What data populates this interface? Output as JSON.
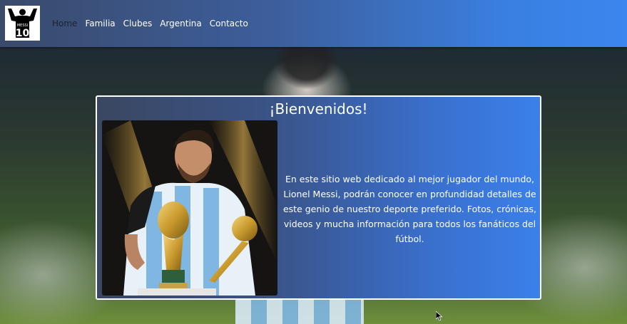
{
  "nav": {
    "logo_label": "MESSI",
    "logo_number": "10",
    "links": [
      {
        "label": "Home",
        "active": true
      },
      {
        "label": "Familia",
        "active": false
      },
      {
        "label": "Clubes",
        "active": false
      },
      {
        "label": "Argentina",
        "active": false
      },
      {
        "label": "Contacto",
        "active": false
      }
    ]
  },
  "welcome": {
    "title": "¡Bienvenidos!",
    "text": "En este sitio web dedicado al mejor jugador del mundo, Lionel Messi, podrán conocer en profundidad detalles de este genio de nuestro deporte preferido. Fotos, crónicas, videos y mucha información para todos los fanáticos del fútbol."
  },
  "colors": {
    "nav_gradient_end": "#3b86ef",
    "card_border": "#ffffff",
    "active_link": "#1c2230"
  }
}
